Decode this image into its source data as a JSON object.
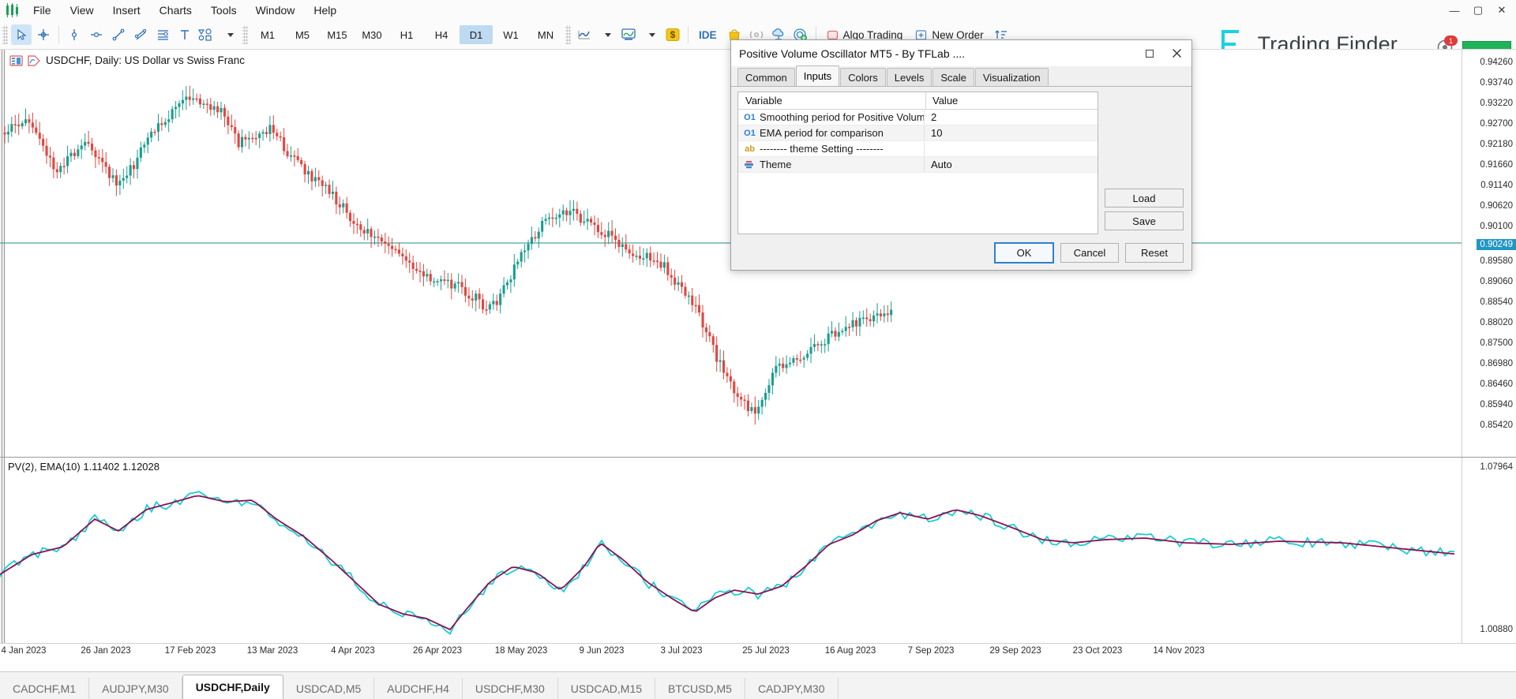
{
  "window": {
    "minimize": "—",
    "maximize": "▢",
    "close": "✕"
  },
  "menubar": {
    "logo_icon": "metatrader-logo-icon",
    "items": [
      {
        "label": "File"
      },
      {
        "label": "View"
      },
      {
        "label": "Insert"
      },
      {
        "label": "Charts"
      },
      {
        "label": "Tools"
      },
      {
        "label": "Window"
      },
      {
        "label": "Help"
      }
    ]
  },
  "toolbar": {
    "cursor_tools": [
      {
        "name": "cursor-arrow-icon",
        "active": true
      },
      {
        "name": "crosshair-icon",
        "active": false
      },
      {
        "name": "vertical-line-icon",
        "active": false
      },
      {
        "name": "horizontal-line-icon",
        "active": false
      },
      {
        "name": "trendline-icon",
        "active": false
      },
      {
        "name": "equidistant-channel-icon",
        "active": false
      },
      {
        "name": "fibonacci-retracement-icon",
        "active": false
      },
      {
        "name": "text-tool-icon",
        "active": false
      },
      {
        "name": "shapes-icon",
        "active": false
      }
    ],
    "timeframes": [
      {
        "label": "M1",
        "active": false
      },
      {
        "label": "M5",
        "active": false
      },
      {
        "label": "M15",
        "active": false
      },
      {
        "label": "M30",
        "active": false
      },
      {
        "label": "H1",
        "active": false
      },
      {
        "label": "H4",
        "active": false
      },
      {
        "label": "D1",
        "active": true
      },
      {
        "label": "W1",
        "active": false
      },
      {
        "label": "MN",
        "active": false
      }
    ],
    "right_tools": [
      {
        "name": "chart-type-icon"
      },
      {
        "name": "indicators-icon"
      },
      {
        "name": "dollar-icon"
      },
      {
        "name": "ide-label",
        "label": "IDE"
      },
      {
        "name": "market-bag-icon"
      },
      {
        "name": "signals-icon"
      },
      {
        "name": "cloud-upload-icon"
      },
      {
        "name": "vps-icon"
      }
    ],
    "algo_trading": {
      "label": "Algo Trading",
      "icon": "algo-trading-icon"
    },
    "new_order": {
      "label": "New Order",
      "icon": "new-order-icon"
    },
    "sort_icon": "sort-icon"
  },
  "brand": {
    "name": "Trading Finder",
    "logo_icon": "trading-finder-logo-icon",
    "notification_icon": "notification-bell-icon",
    "notification_count": "1",
    "status_bar_color": "#21b35a"
  },
  "chart": {
    "symbol_label": "USDCHF, Daily:  US Dollar vs Swiss Franc",
    "symbol_icon_1": "chart-properties-icon",
    "symbol_icon_2": "chart-shift-icon",
    "indicator_label": "PV(2),  EMA(10) 1.11402 1.12028",
    "current_price": "0.90249",
    "current_price_color": "#2196c4",
    "price_labels": [
      "0.94260",
      "0.93740",
      "0.93220",
      "0.92700",
      "0.92180",
      "0.91660",
      "0.91140",
      "0.90620",
      "0.90100",
      "0.89580",
      "0.89060",
      "0.88540",
      "0.88020",
      "0.87500",
      "0.86980",
      "0.86460",
      "0.85940",
      "0.85420"
    ],
    "sub_price_labels": [
      "1.07964",
      "1.00880"
    ],
    "time_labels": [
      "4 Jan 2023",
      "26 Jan 2023",
      "17 Feb 2023",
      "13 Mar 2023",
      "4 Apr 2023",
      "26 Apr 2023",
      "18 May 2023",
      "9 Jun 2023",
      "3 Jul 2023",
      "25 Jul 2023",
      "16 Aug 2023",
      "7 Sep 2023",
      "29 Sep 2023",
      "23 Oct 2023",
      "14 Nov 2023"
    ],
    "colors": {
      "bull_candle": "#1a9e8f",
      "bear_candle": "#e2463f",
      "pv_line": "#17cfd6",
      "ema_line": "#8e1050",
      "level_line": "#4aa3a0"
    }
  },
  "chart_tabs": [
    {
      "label": "CADCHF,M1",
      "active": false
    },
    {
      "label": "AUDJPY,M30",
      "active": false
    },
    {
      "label": "USDCHF,Daily",
      "active": true
    },
    {
      "label": "USDCAD,M5",
      "active": false
    },
    {
      "label": "AUDCHF,H4",
      "active": false
    },
    {
      "label": "USDCHF,M30",
      "active": false
    },
    {
      "label": "USDCAD,M15",
      "active": false
    },
    {
      "label": "BTCUSD,M5",
      "active": false
    },
    {
      "label": "CADJPY,M30",
      "active": false
    }
  ],
  "dialog": {
    "title": "Positive Volume Oscillator MT5 - By TFLab ....",
    "minimize_icon": "minimize-icon",
    "close_icon": "close-icon",
    "tabs": [
      {
        "label": "Common",
        "active": false
      },
      {
        "label": "Inputs",
        "active": true
      },
      {
        "label": "Colors",
        "active": false
      },
      {
        "label": "Levels",
        "active": false
      },
      {
        "label": "Scale",
        "active": false
      },
      {
        "label": "Visualization",
        "active": false
      }
    ],
    "grid": {
      "columns": [
        "Variable",
        "Value"
      ],
      "rows": [
        {
          "icon": "integer-input-icon",
          "icon_text": "O1",
          "icon_kind": "num",
          "variable": "Smoothing period for Positive Volume",
          "value": "2"
        },
        {
          "icon": "integer-input-icon",
          "icon_text": "O1",
          "icon_kind": "num",
          "variable": "EMA period for comparison",
          "value": "10"
        },
        {
          "icon": "string-input-icon",
          "icon_text": "ab",
          "icon_kind": "str",
          "variable": "-------- theme Setting --------",
          "value": ""
        },
        {
          "icon": "enum-input-icon",
          "icon_text": "",
          "icon_kind": "enum",
          "variable": "Theme",
          "value": "Auto"
        }
      ]
    },
    "side_buttons": [
      {
        "label": "Load"
      },
      {
        "label": "Save"
      }
    ],
    "footer_buttons": [
      {
        "label": "OK",
        "default": true
      },
      {
        "label": "Cancel",
        "default": false
      },
      {
        "label": "Reset",
        "default": false
      }
    ]
  },
  "chart_data": {
    "type": "line",
    "title": "Positive Volume Oscillator",
    "series": [
      {
        "name": "PV(2)",
        "color": "#17cfd6",
        "value": "1.11402"
      },
      {
        "name": "EMA(10)",
        "color": "#8e1050",
        "value": "1.12028"
      }
    ],
    "ylim": [
      1.0088,
      1.07964
    ],
    "xlabel": "",
    "ylabel": ""
  }
}
